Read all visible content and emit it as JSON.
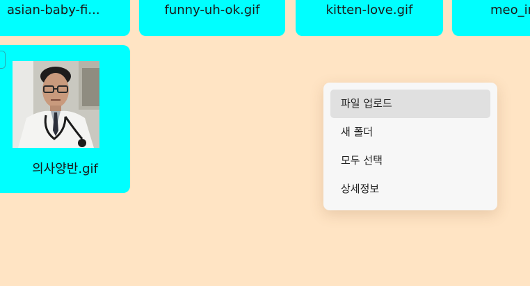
{
  "files": [
    {
      "name": "asian-baby-fi..."
    },
    {
      "name": "funny-uh-ok.gif"
    },
    {
      "name": "kitten-love.gif"
    },
    {
      "name": "meo_in"
    },
    {
      "name": "의사양반.gif"
    }
  ],
  "context_menu": {
    "items": [
      {
        "label": "파일 업로드",
        "highlighted": true
      },
      {
        "label": "새 폴더"
      },
      {
        "label": "모두 선택"
      },
      {
        "label": "상세정보"
      }
    ]
  },
  "colors": {
    "background": "#ffe4c4",
    "tile": "#00ffff",
    "menu_background": "#f7f7f7",
    "menu_highlight": "#e0e0e0"
  }
}
